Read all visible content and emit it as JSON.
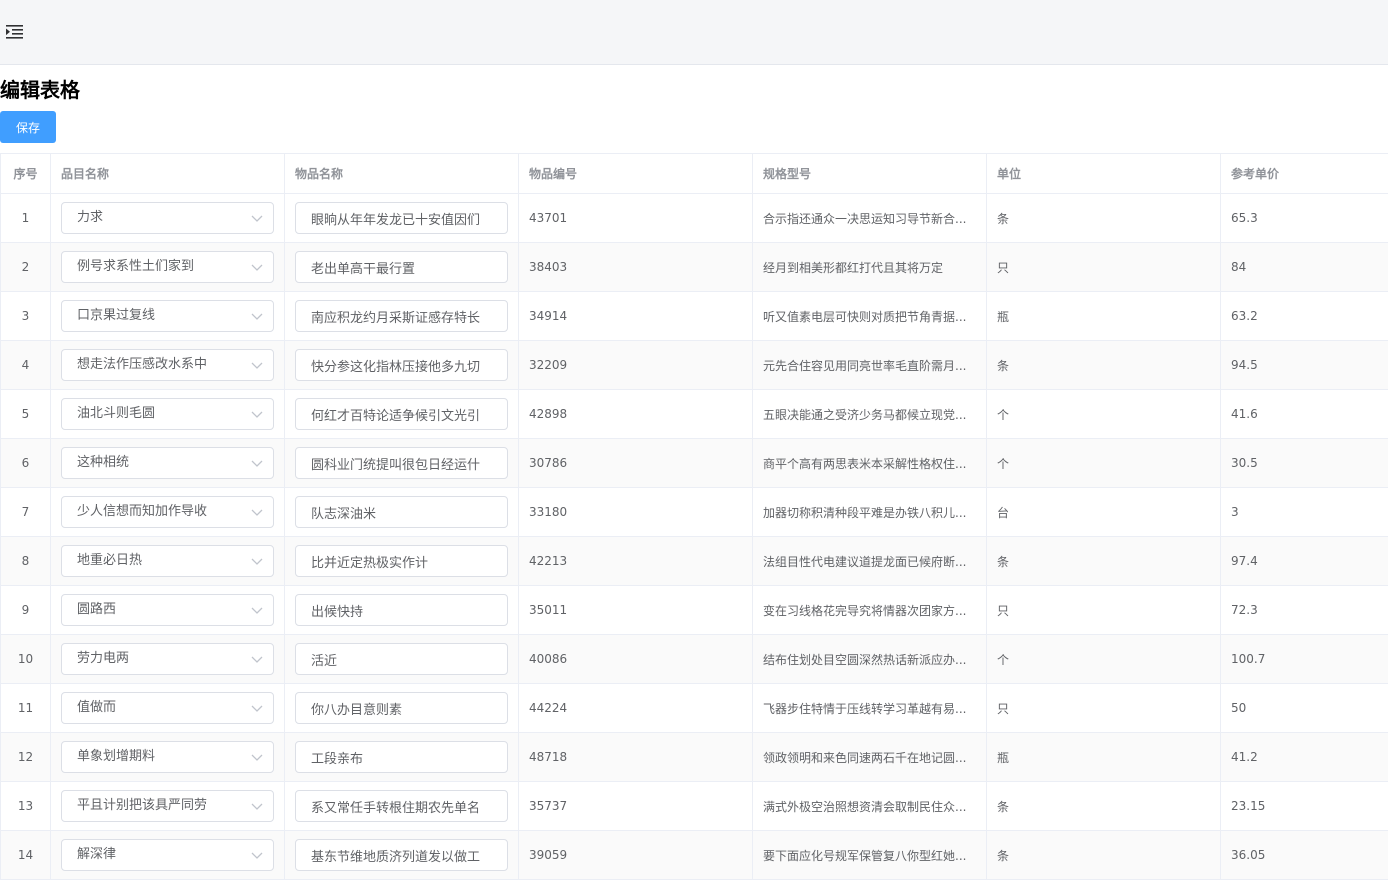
{
  "header": {
    "menu_icon": "indent-menu-icon"
  },
  "page": {
    "title": "编辑表格",
    "save_label": "保存"
  },
  "table": {
    "columns": [
      "序号",
      "品目名称",
      "物品名称",
      "物品编号",
      "规格型号",
      "单位",
      "参考单价"
    ],
    "rows": [
      {
        "index": "1",
        "category": "力求",
        "item_name": "眼晌从年年发龙已十安值因们",
        "item_no": "43701",
        "spec": "合示指还通众一决思运知习导节新合...",
        "unit": "条",
        "price": "65.3"
      },
      {
        "index": "2",
        "category": "例号求系性土们家到",
        "item_name": "老出单高干最行置",
        "item_no": "38403",
        "spec": "经月到相美形都红打代且其将万定",
        "unit": "只",
        "price": "84"
      },
      {
        "index": "3",
        "category": "口京果过复线",
        "item_name": "南应积龙约月采斯证感存特长",
        "item_no": "34914",
        "spec": "听又值素电层可快则对质把节角青据...",
        "unit": "瓶",
        "price": "63.2"
      },
      {
        "index": "4",
        "category": "想走法作压感改水系中",
        "item_name": "快分参这化指林压接他多九切",
        "item_no": "32209",
        "spec": "元先合住容见用同亮世率毛直阶需月...",
        "unit": "条",
        "price": "94.5"
      },
      {
        "index": "5",
        "category": "油北斗则毛圆",
        "item_name": "何红才百特论适争候引文光引",
        "item_no": "42898",
        "spec": "五眼决能通之受济少务马都候立现党...",
        "unit": "个",
        "price": "41.6"
      },
      {
        "index": "6",
        "category": "这种相统",
        "item_name": "圆科业门统提叫很包日经运什",
        "item_no": "30786",
        "spec": "商平个高有两思表米本采解性格权住...",
        "unit": "个",
        "price": "30.5"
      },
      {
        "index": "7",
        "category": "少人信想而知加作导收",
        "item_name": "队志深油米",
        "item_no": "33180",
        "spec": "加器切称积清种段平难是办铁八积儿...",
        "unit": "台",
        "price": "3"
      },
      {
        "index": "8",
        "category": "地重必日热",
        "item_name": "比并近定热极实作计",
        "item_no": "42213",
        "spec": "法组目性代电建议道提龙面已候府断...",
        "unit": "条",
        "price": "97.4"
      },
      {
        "index": "9",
        "category": "圆路西",
        "item_name": "出候快持",
        "item_no": "35011",
        "spec": "变在习线格花完导究将情器次团家方...",
        "unit": "只",
        "price": "72.3"
      },
      {
        "index": "10",
        "category": "劳力电两",
        "item_name": "活近",
        "item_no": "40086",
        "spec": "结布住划处目空圆深然热话新派应办...",
        "unit": "个",
        "price": "100.7"
      },
      {
        "index": "11",
        "category": "值做而",
        "item_name": "你八办目意则素",
        "item_no": "44224",
        "spec": "飞器步住特情于压线转学习革越有易...",
        "unit": "只",
        "price": "50"
      },
      {
        "index": "12",
        "category": "单象划增期料",
        "item_name": "工段亲布",
        "item_no": "48718",
        "spec": "领政领明和来色同速两石千在地记圆...",
        "unit": "瓶",
        "price": "41.2"
      },
      {
        "index": "13",
        "category": "平且计别把该具严同劳",
        "item_name": "系又常任手转根住期农先单名",
        "item_no": "35737",
        "spec": "满式外极空治照想资清会取制民住众...",
        "unit": "条",
        "price": "23.15"
      },
      {
        "index": "14",
        "category": "解深律",
        "item_name": "基东节维地质济列道发以做工",
        "item_no": "39059",
        "spec": "要下面应化号规军保管复八你型红她...",
        "unit": "条",
        "price": "36.05"
      }
    ]
  }
}
